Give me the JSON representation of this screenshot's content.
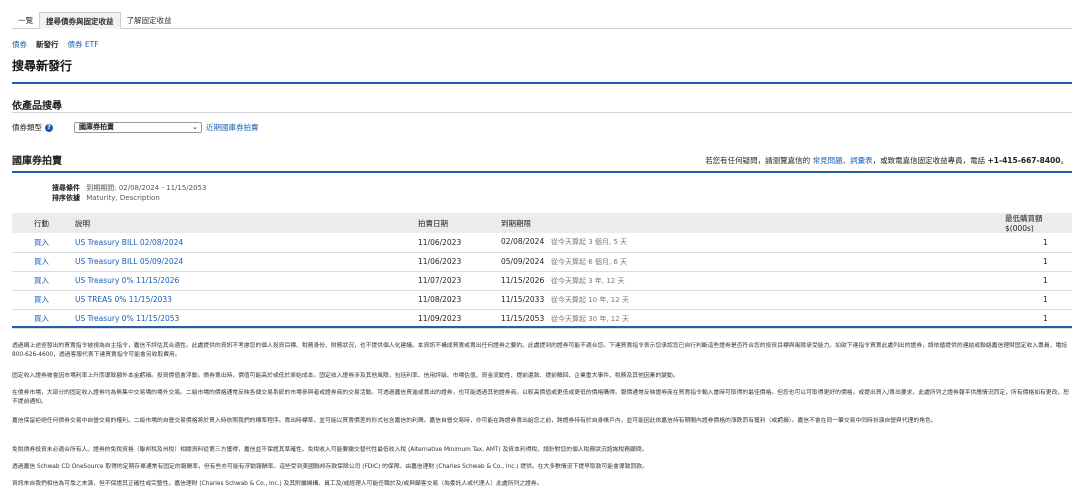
{
  "tabs": [
    {
      "label": "一覽"
    },
    {
      "label": "搜尋債券與固定收益"
    },
    {
      "label": "了解固定收益"
    }
  ],
  "subnav": [
    {
      "label": "債券"
    },
    {
      "label": "新發行"
    },
    {
      "label": "債券 ETF"
    }
  ],
  "page_title": "搜尋新發行",
  "product_search": {
    "title": "依產品搜尋",
    "type_label": "債券類型",
    "selected": "國庫券拍賣",
    "recent_link": "近期國庫券拍賣"
  },
  "auction": {
    "title": "國庫券拍賣",
    "help_prefix": "若您有任何疑問，請瀏覽嘉信的",
    "faq_link": "常見問題",
    "sep": "、",
    "glossary_link": "詞彙表",
    "help_mid": "，或致電嘉信固定收益專員，電話",
    "phone": "+1-415-667-8400",
    "help_end": "。"
  },
  "criteria": {
    "search_label": "搜尋條件",
    "search_value": "到期期間: 02/08/2024 - 11/15/2053",
    "sort_label": "排序依據",
    "sort_value": "Maturity, Description"
  },
  "table": {
    "headers": {
      "action": "行動",
      "desc": "說明",
      "auction": "拍賣日期",
      "maturity": "到期期限",
      "min": "最低購買額 $(000s)"
    },
    "rows": [
      {
        "action": "買入",
        "desc": "US Treasury BILL 02/08/2024",
        "auction": "11/06/2023",
        "maturity": "02/08/2024",
        "note": "從今天算起 3 個月, 5 天",
        "min": "1"
      },
      {
        "action": "買入",
        "desc": "US Treasury BILL 05/09/2024",
        "auction": "11/06/2023",
        "maturity": "05/09/2024",
        "note": "從今天算起 6 個月, 6 天",
        "min": "1"
      },
      {
        "action": "買入",
        "desc": "US Treasury 0% 11/15/2026",
        "auction": "11/07/2023",
        "maturity": "11/15/2026",
        "note": "從今天算起 3 年, 12 天",
        "min": "1"
      },
      {
        "action": "買入",
        "desc": "US TREAS 0% 11/15/2033",
        "auction": "11/08/2023",
        "maturity": "11/15/2033",
        "note": "從今天算起 10 年, 12 天",
        "min": "1"
      },
      {
        "action": "買入",
        "desc": "US Treasury 0% 11/15/2053",
        "auction": "11/09/2023",
        "maturity": "11/15/2053",
        "note": "從今天算起 30 年, 12 天",
        "min": "1"
      }
    ]
  },
  "disclaimers": [
    "透過網上途徑發出的買賣指令被視為自主指令，嘉信不評估其合適性。此處提供的資訊不考慮您的個人投資目標、稅務身份、財務狀況，也不提供個人化建議。本資訊不構成買賣或賣出任何證券之要約。此處提到的證券可能不適合您。下達買賣指令表示您承認您已自行判斷這些證券是否符合您的投資目標與風險承受能力。如欲下達指令買賣此處列出的證券，請依循提供的連結或聯絡嘉信理財固定收入專員，電話 800-626-4600，透過客服代表下達買賣指令可能會另收取費用。",
    "固定收入證券被會因市場利率上升而導致額外本金虧損。投資價值會浮動。債券賣出時，價值可能高於或低於原始成本。固定收入證券涉及其他風險，包括利率、信用評級、市場估值、資金流動性、提前還款、提前贖回、企業重大事件、稅務及其他因素的變動。",
    "在債券市場，大部分的固定收入證券均為無集中交易場的場外交易。二級市場的價格通常反映各個交易系統的市場參與者或證券商的交易活動。可透過嘉信買進或賣出的證券，也可能透過其他證券商。以較高價值或更低或更低的價格購得。報價通常反映證券商在買賣指令輸入當時可取得的最佳價格。但您也可以可取得更好的價格，或提出買入/賣出要求。此處所列之證券報平供應情況而定，所有價格如有更改，恕不提前通知。",
    "嘉信保留拒絕任何債券交易中自營交易的權利。二級市場的自營交易價格將於買入時依照我們的標準程序。賣出時標準，並可能以買賣價差的形式包含嘉信的利潤。嘉信自營交易時，亦可能在跨證券賣出給您之前，跨證券持有於自身帳戶內，並可能因此依嘉信持有期間內證券價格的漲跌而有獲利（或虧損）。嘉信不會在同一筆交易中同時扮演自營與代理的角色。",
    "免稅債券投資未必適合所有人。證券的免稅資格（聯邦稅及州稅）相關資料從第三方獲得，嘉信並不保證其準確性。免稅收入可能要繳交替代性最低收入稅 (Alternative Minimum Tax, AMT) 及資本利得稅。請針對您的個人稅務狀況諮詢稅務顧問。",
    "透過嘉信 Schwab CD OneSource 取得的定期存單通常有固定的報酬率，但有些亦可能有浮動報酬率。這些受到美國聯邦存款保險公司 (FDIC) 的保障。由嘉信理財 (Charles Schwab & Co., Inc.) 提供。在大多數情況下提早取款可能會導致罰款。",
    "資訊來自我們相信為可靠之來源，但不保證其正確性或完整性。嘉信理財 (Charles Schwab & Co., Inc.) 及其附屬機構、員工及/或經理人可能任職於及/或與顧客交易（為委託人或代理人）此處所列之證券。"
  ]
}
